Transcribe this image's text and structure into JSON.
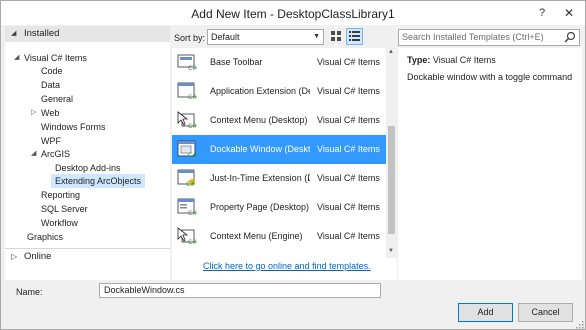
{
  "window": {
    "title": "Add New Item - DesktopClassLibrary1",
    "help_glyph": "?",
    "close_glyph": "✕"
  },
  "sidebar": {
    "installed_label": "Installed",
    "online_label": "Online",
    "tree": [
      {
        "label": "Visual C# Items",
        "expander": "◢"
      },
      {
        "label": "Code"
      },
      {
        "label": "Data"
      },
      {
        "label": "General"
      },
      {
        "label": "Web",
        "expander": "▷"
      },
      {
        "label": "Windows Forms"
      },
      {
        "label": "WPF"
      },
      {
        "label": "ArcGIS",
        "expander": "◢"
      },
      {
        "label": "Desktop Add-ins"
      },
      {
        "label": "Extending ArcObjects",
        "selected": true
      },
      {
        "label": "Reporting"
      },
      {
        "label": "SQL Server"
      },
      {
        "label": "Workflow"
      },
      {
        "label": "Graphics"
      }
    ]
  },
  "toolbar": {
    "sort_label": "Sort by:",
    "sort_value": "Default",
    "search_placeholder": "Search Installed Templates (Ctrl+E)"
  },
  "templates": [
    {
      "name": "Base Toolbar",
      "category": "Visual C# Items",
      "icon": "toolbar-icon"
    },
    {
      "name": "Application Extension (De...",
      "category": "Visual C# Items",
      "icon": "app-extension-icon"
    },
    {
      "name": "Context Menu (Desktop)",
      "category": "Visual C# Items",
      "icon": "context-menu-icon"
    },
    {
      "name": "Dockable Window (Deskt...",
      "category": "Visual C# Items",
      "icon": "dockable-window-icon",
      "selected": true
    },
    {
      "name": "Just-In-Time Extension (D...",
      "category": "Visual C# Items",
      "icon": "jit-extension-icon"
    },
    {
      "name": "Property Page (Desktop)",
      "category": "Visual C# Items",
      "icon": "property-page-icon"
    },
    {
      "name": "Context Menu (Engine)",
      "category": "Visual C# Items",
      "icon": "context-menu-icon"
    }
  ],
  "online_link": "Click here to go online and find templates.",
  "details": {
    "type_label": "Type:",
    "type_value": "Visual C# Items",
    "description": "Dockable window with a toggle command"
  },
  "footer": {
    "name_label": "Name:",
    "name_value": "DockableWindow.cs",
    "add_label": "Add",
    "cancel_label": "Cancel"
  },
  "colors": {
    "selection": "#3399ff",
    "tree_selection": "#cde8ff",
    "link": "#0066cc"
  }
}
